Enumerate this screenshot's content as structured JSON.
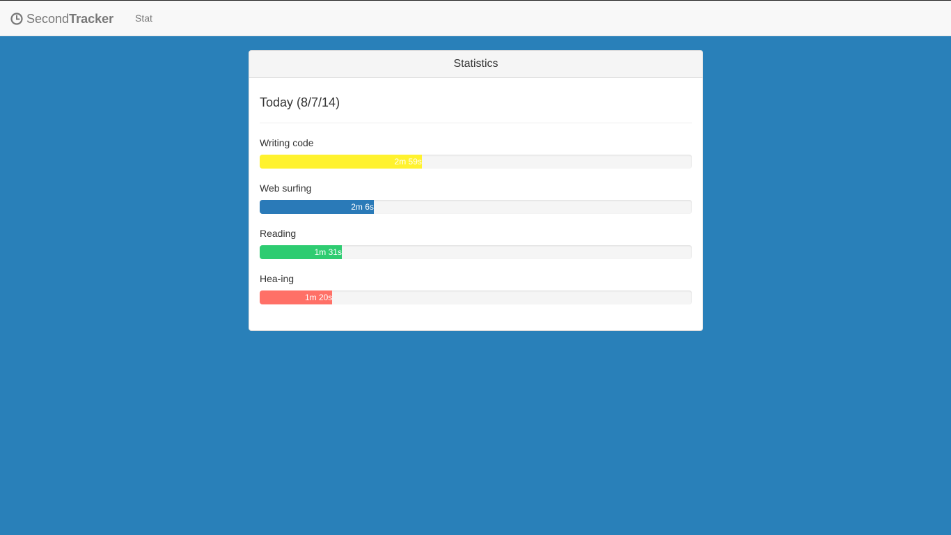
{
  "navbar": {
    "brand_light": "Second",
    "brand_bold": "Tracker",
    "brand_icon": "clock-icon",
    "link_stat": "Stat"
  },
  "panel": {
    "heading": "Statistics",
    "today_label": "Today (8/7/14)",
    "activities": [
      {
        "label": "Writing code",
        "duration": "2m 59s",
        "seconds": 179,
        "fraction": 0.375,
        "color": "#fff22e"
      },
      {
        "label": "Web surfing",
        "duration": "2m 6s",
        "seconds": 126,
        "fraction": 0.264,
        "color": "#2a7ab8"
      },
      {
        "label": "Reading",
        "duration": "1m 31s",
        "seconds": 91,
        "fraction": 0.19,
        "color": "#2ecc71"
      },
      {
        "label": "Hea-ing",
        "duration": "1m 20s",
        "seconds": 80,
        "fraction": 0.168,
        "color": "#ff7067"
      }
    ]
  },
  "colors": {
    "background": "#2980b9",
    "navbar": "#f8f8f8"
  }
}
